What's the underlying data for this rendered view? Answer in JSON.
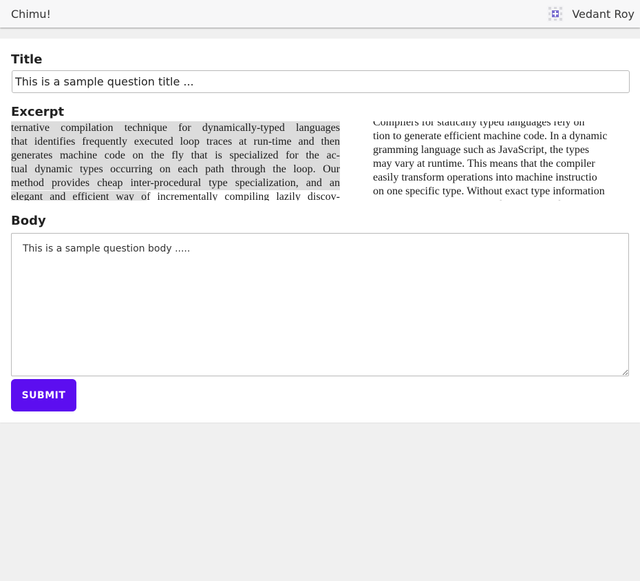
{
  "app": {
    "brand": "Chimu!"
  },
  "user": {
    "name": "Vedant Roy",
    "avatar_icon": "avatar-identicon",
    "avatar_color": "#7b6fd0"
  },
  "form": {
    "title_label": "Title",
    "title_value": "This is a sample question title ...",
    "excerpt_label": "Excerpt",
    "body_label": "Body",
    "body_value": "This is a sample question body .....",
    "submit_label": "SUBMIT",
    "submit_color": "#5c0ef0"
  },
  "excerpt": {
    "left_lines": [
      {
        "highlighted": "ternative compilation technique for dynamically-typed languages",
        "plain": ""
      },
      {
        "highlighted": "that identifies frequently executed loop traces at run-time and then",
        "plain": ""
      },
      {
        "highlighted": "generates machine code on the fly that is specialized for the ac-",
        "plain": ""
      },
      {
        "highlighted": "tual dynamic types occurring on each path through the loop. Our",
        "plain": ""
      },
      {
        "highlighted": "method provides cheap inter-procedural type specialization, and an",
        "plain": ""
      },
      {
        "highlighted": "elegant and efficient way o",
        "plain": "f incrementally compiling lazily discov-"
      }
    ],
    "right_lines": [
      "     Compilers for statically typed languages rely on",
      "tion to generate efficient machine code. In a dynamic",
      "gramming language such as JavaScript, the types",
      "may vary at runtime. This means that the compiler",
      "easily transform operations into machine instructio",
      "on one specific type. Without exact type information",
      "must emit slower generalized machine code that ca"
    ]
  }
}
